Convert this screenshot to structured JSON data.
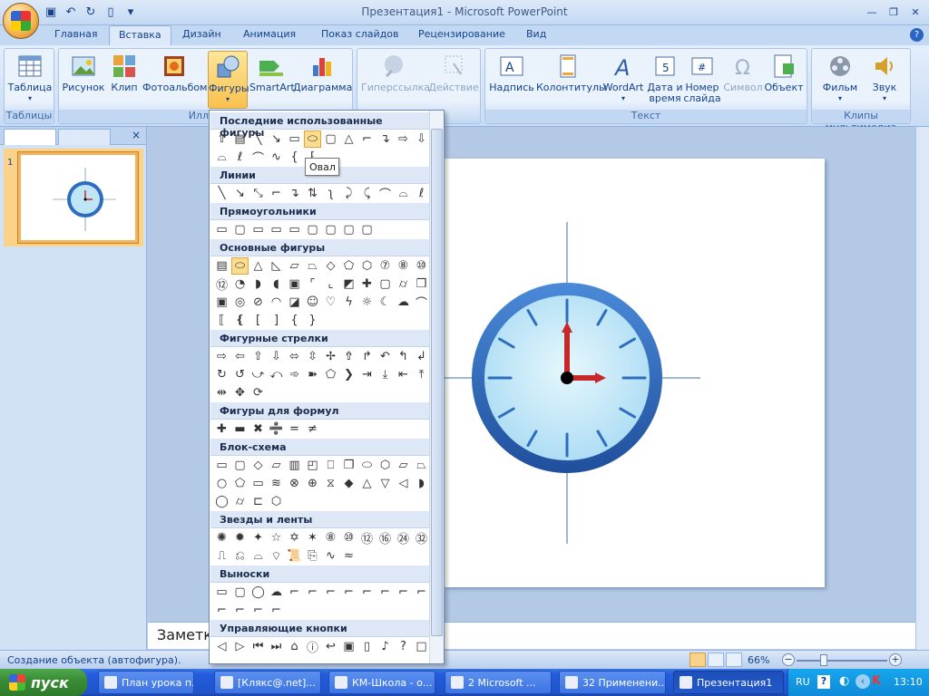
{
  "title_bar": {
    "title": "Презентация1 - Microsoft PowerPoint"
  },
  "tabs": [
    "Главная",
    "Вставка",
    "Дизайн",
    "Анимация",
    "Показ слайдов",
    "Рецензирование",
    "Вид"
  ],
  "ribbon": {
    "tables": {
      "group_label": "Таблицы",
      "table_label": "Таблица"
    },
    "illustrations": {
      "group_label": "Иллюс",
      "picture": "Рисунок",
      "clip": "Клип",
      "photoalbum": "Фотоальбом",
      "shapes": "Фигуры",
      "smartart": "SmartArt",
      "chart": "Диаграмма"
    },
    "links": {
      "hyperlink": "Гиперссылка",
      "action": "Действие"
    },
    "text": {
      "group_label": "Текст",
      "textbox": "Надпись",
      "header": "Колонтитулы",
      "wordart": "WordArt",
      "datetime_1": "Дата и",
      "datetime_2": "время",
      "slidenum_1": "Номер",
      "slidenum_2": "слайда",
      "symbol": "Символ",
      "object": "Объект"
    },
    "media": {
      "group_label": "Клипы мультимедиа",
      "movie": "Фильм",
      "sound": "Звук"
    }
  },
  "shapes_gallery": {
    "sections": [
      "Последние использованные фигуры",
      "Линии",
      "Прямоугольники",
      "Основные фигуры",
      "Фигурные стрелки",
      "Фигуры для формул",
      "Блок-схема",
      "Звезды и ленты",
      "Выноски",
      "Управляющие кнопки"
    ],
    "tooltip": "Овал"
  },
  "slide_panel": {
    "slide_number": "1"
  },
  "notes_placeholder": "Заметки",
  "status_bar": {
    "text": "Создание объекта (автофигура).",
    "zoom": "66%"
  },
  "taskbar": {
    "start": "пуск",
    "tasks": [
      "План урока п...",
      "[Клякс@.net]...",
      "КМ-Школа - о...",
      "2 Microsoft ...",
      "32 Применени...",
      "Презентация1"
    ],
    "lang": "RU",
    "clock": "13:10"
  },
  "colors": {
    "ribbon_bg": "#dde9f8",
    "clock_rim": "#2e6cc0",
    "clock_face": "#bfe6f7",
    "hand_red": "#c62828"
  }
}
